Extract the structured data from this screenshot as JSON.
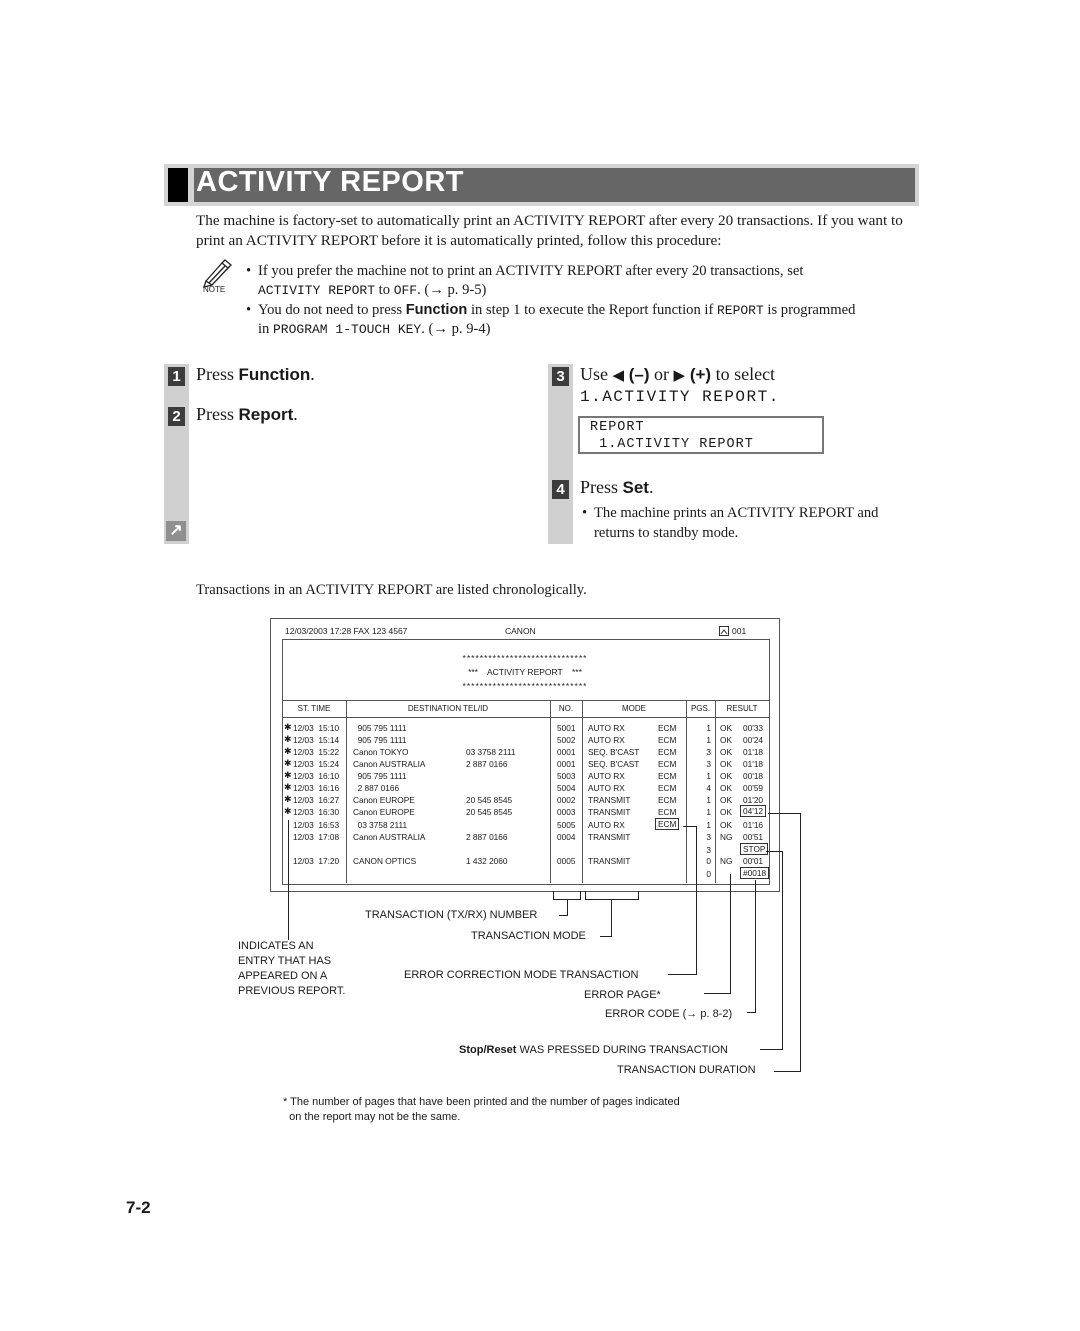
{
  "section": {
    "title": "ACTIVITY REPORT",
    "intro": "The machine is factory-set to automatically print an ACTIVITY REPORT after every 20 transactions. If you want to print an ACTIVITY REPORT before it is automatically printed, follow this procedure:"
  },
  "note": {
    "icon": "pencil-note-icon",
    "label": "NOTE",
    "items": [
      {
        "line1": "If you prefer the machine not to print an ACTIVITY REPORT after every 20 transactions, set",
        "code1": "ACTIVITY REPORT",
        "mid": " to ",
        "code2": "OFF",
        "ref": ". (→ p. 9-5)"
      },
      {
        "pre": "You do not need to press ",
        "key": "Function",
        "post": " in step 1 to execute the Report function if ",
        "code1": "REPORT",
        "post2": " is programmed",
        "line2pre": "in ",
        "code2": "PROGRAM 1-TOUCH KEY",
        "ref": ". (→ p. 9-4)"
      }
    ]
  },
  "steps": [
    {
      "num": "1",
      "pre": "Press ",
      "key": "Function",
      "post": "."
    },
    {
      "num": "2",
      "pre": "Press ",
      "key": "Report",
      "post": "."
    },
    {
      "num": "3",
      "pre": "Use ",
      "left_arrow": "◀",
      "minus": " (–)",
      "or": " or ",
      "right_arrow": "▶",
      "plus": " (+)",
      "post": " to select",
      "line2": "1.ACTIVITY REPORT."
    },
    {
      "num": "4",
      "pre": "Press ",
      "key": "Set",
      "post": ".",
      "bullet": "The machine prints an ACTIVITY REPORT and returns to standby mode."
    }
  ],
  "continue_icon": "↗",
  "lcd": {
    "line1": "REPORT",
    "line2": " 1.ACTIVITY REPORT"
  },
  "chronological_note": "Transactions in an ACTIVITY REPORT are listed chronologically.",
  "report": {
    "header_left": "12/03/2003  17:28  FAX 123 4567",
    "header_center": "CANON",
    "header_page_icon": "page-icon",
    "header_page": "001",
    "stars": "*****************************",
    "title": "***    ACTIVITY REPORT    ***",
    "columns": [
      "ST. TIME",
      "DESTINATION TEL/ID",
      "NO.",
      "MODE",
      "PGS.",
      "RESULT"
    ],
    "rows": [
      {
        "mark": "✱",
        "time": "12/03  15:10",
        "dest": "  905 795 1111",
        "tel": "",
        "no": "5001",
        "mode": "AUTO RX",
        "ecm": "ECM",
        "pgs": "1",
        "res": "OK",
        "dur": "00'33"
      },
      {
        "mark": "✱",
        "time": "12/03  15:14",
        "dest": "  905 795 1111",
        "tel": "",
        "no": "5002",
        "mode": "AUTO RX",
        "ecm": "ECM",
        "pgs": "1",
        "res": "OK",
        "dur": "00'24"
      },
      {
        "mark": "✱",
        "time": "12/03  15:22",
        "dest": "Canon TOKYO",
        "tel": "03 3758 2111",
        "no": "0001",
        "mode": "SEQ. B'CAST",
        "ecm": "ECM",
        "pgs": "3",
        "res": "OK",
        "dur": "01'18"
      },
      {
        "mark": "✱",
        "time": "12/03  15:24",
        "dest": "Canon AUSTRALIA",
        "tel": "2 887 0166",
        "no": "0001",
        "mode": "SEQ. B'CAST",
        "ecm": "ECM",
        "pgs": "3",
        "res": "OK",
        "dur": "01'18"
      },
      {
        "mark": "✱",
        "time": "12/03  16:10",
        "dest": "  905 795 1111",
        "tel": "",
        "no": "5003",
        "mode": "AUTO RX",
        "ecm": "ECM",
        "pgs": "1",
        "res": "OK",
        "dur": "00'18"
      },
      {
        "mark": "✱",
        "time": "12/03  16:16",
        "dest": "  2 887 0166",
        "tel": "",
        "no": "5004",
        "mode": "AUTO RX",
        "ecm": "ECM",
        "pgs": "4",
        "res": "OK",
        "dur": "00'59"
      },
      {
        "mark": "✱",
        "time": "12/03  16:27",
        "dest": "Canon EUROPE",
        "tel": "20 545 8545",
        "no": "0002",
        "mode": "TRANSMIT",
        "ecm": "ECM",
        "pgs": "1",
        "res": "OK",
        "dur": "01'20"
      },
      {
        "mark": "✱",
        "time": "12/03  16:30",
        "dest": "Canon EUROPE",
        "tel": "20 545 8545",
        "no": "0003",
        "mode": "TRANSMIT",
        "ecm": "ECM",
        "pgs": "1",
        "res": "OK",
        "dur": "04'12"
      },
      {
        "mark": "",
        "time": "12/03  16:53",
        "dest": "  03 3758 2111",
        "tel": "",
        "no": "5005",
        "mode": "AUTO RX",
        "ecm": "ECM",
        "pgs": "1",
        "res": "OK",
        "dur": "01'16"
      },
      {
        "mark": "",
        "time": "12/03  17:08",
        "dest": "Canon AUSTRALIA",
        "tel": "2 887 0166",
        "no": "0004",
        "mode": "TRANSMIT",
        "ecm": "",
        "pgs": "3",
        "res": "NG",
        "dur": "00'51"
      },
      {
        "mark": "",
        "time": "",
        "dest": "",
        "tel": "",
        "no": "",
        "mode": "",
        "ecm": "",
        "pgs": "3",
        "res": "",
        "dur": "STOP"
      },
      {
        "mark": "",
        "time": "12/03  17:20",
        "dest": "CANON OPTICS",
        "tel": "1 432 2060",
        "no": "0005",
        "mode": "TRANSMIT",
        "ecm": "",
        "pgs": "0",
        "res": "NG",
        "dur": "00'01"
      },
      {
        "mark": "",
        "time": "",
        "dest": "",
        "tel": "",
        "no": "",
        "mode": "",
        "ecm": "",
        "pgs": "0",
        "res": "",
        "dur": "#0018"
      }
    ]
  },
  "callouts": {
    "txrx_number": "TRANSACTION (TX/RX) NUMBER",
    "transaction_mode": "TRANSACTION MODE",
    "previous_report": [
      "INDICATES AN",
      "ENTRY THAT HAS",
      "APPEARED ON A",
      "PREVIOUS REPORT."
    ],
    "ecm": "ERROR CORRECTION MODE TRANSACTION",
    "error_page": "ERROR PAGE*",
    "error_code": "ERROR CODE (→ p. 8-2)",
    "stop_key": "Stop/Reset",
    "stop_rest": " WAS PRESSED DURING TRANSACTION",
    "duration": "TRANSACTION DURATION"
  },
  "footnote": [
    "* The number of pages that have been printed and the number of pages indicated",
    "  on the report may not be the same."
  ],
  "page_number": "7-2"
}
